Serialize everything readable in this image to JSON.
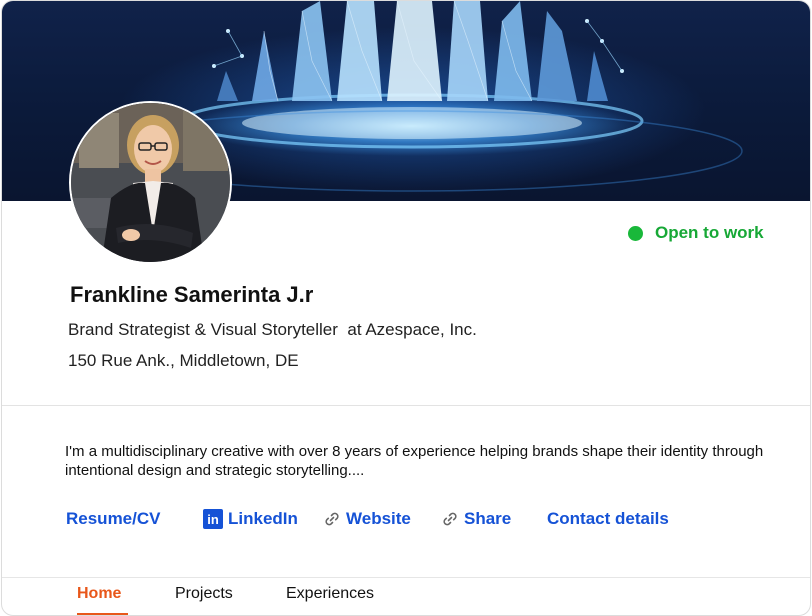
{
  "profile": {
    "name": "Frankline Samerinta J.r",
    "headline": "Brand Strategist & Visual Storyteller  at Azespace, Inc.",
    "location": "150 Rue Ank., Middletown, DE",
    "status": "Open to work",
    "bio": "I'm a multidisciplinary creative with over 8 years of experience helping brands shape their identity through intentional design and strategic storytelling...."
  },
  "links": {
    "resume": "Resume/CV",
    "linkedin": "LinkedIn",
    "linkedin_icon_text": "in",
    "website": "Website",
    "share": "Share",
    "contact": "Contact details"
  },
  "tabs": [
    {
      "label": "Home",
      "active": true
    },
    {
      "label": "Projects",
      "active": false
    },
    {
      "label": "Experiences",
      "active": false
    }
  ],
  "icons": {
    "linkedin": "linkedin-icon",
    "website": "link-icon",
    "share": "link-icon",
    "status": "status-dot-icon"
  },
  "colors": {
    "accent_link": "#1552d6",
    "status_green": "#19b83a",
    "active_tab": "#e8571a"
  }
}
